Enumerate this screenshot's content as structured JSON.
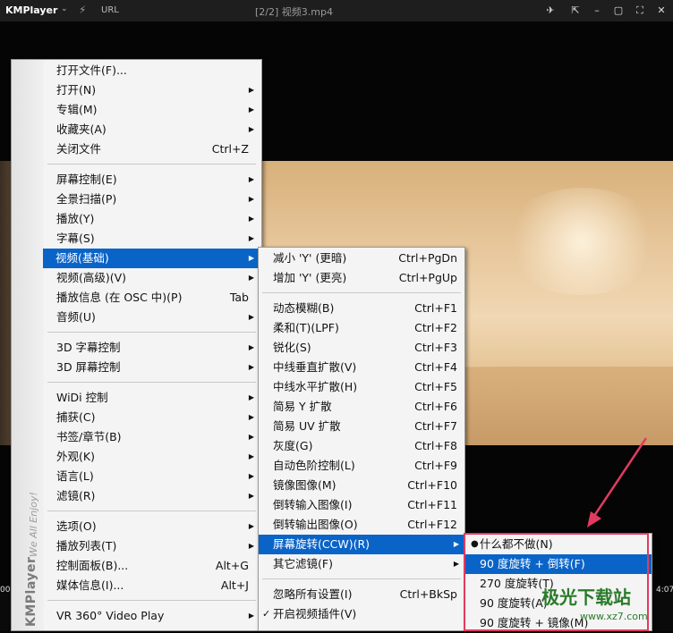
{
  "titlebar": {
    "app": "KMPlayer",
    "url": "URL",
    "title": "[2/2] 视频3.mp4"
  },
  "player": {
    "time_left": "00",
    "time_right": "4:07"
  },
  "main_menu": {
    "brand": "KMPlayer",
    "slogan": "We All Enjoy!",
    "items": [
      {
        "label": "打开文件(F)...",
        "shortcut": "",
        "arrow": false
      },
      {
        "label": "打开(N)",
        "shortcut": "",
        "arrow": true
      },
      {
        "label": "专辑(M)",
        "shortcut": "",
        "arrow": true
      },
      {
        "label": "收藏夹(A)",
        "shortcut": "",
        "arrow": true
      },
      {
        "label": "关闭文件",
        "shortcut": "Ctrl+Z",
        "arrow": false
      },
      {
        "label": "屏幕控制(E)",
        "shortcut": "",
        "arrow": true
      },
      {
        "label": "全景扫描(P)",
        "shortcut": "",
        "arrow": true
      },
      {
        "label": "播放(Y)",
        "shortcut": "",
        "arrow": true
      },
      {
        "label": "字幕(S)",
        "shortcut": "",
        "arrow": true
      },
      {
        "label": "视频(基础)",
        "shortcut": "",
        "arrow": true,
        "highlighted": true
      },
      {
        "label": "视频(高级)(V)",
        "shortcut": "",
        "arrow": true
      },
      {
        "label": "播放信息 (在 OSC 中)(P)",
        "shortcut": "Tab",
        "arrow": false
      },
      {
        "label": "音频(U)",
        "shortcut": "",
        "arrow": true
      },
      {
        "label": "3D 字幕控制",
        "shortcut": "",
        "arrow": true
      },
      {
        "label": "3D 屏幕控制",
        "shortcut": "",
        "arrow": true
      },
      {
        "label": "WiDi 控制",
        "shortcut": "",
        "arrow": true
      },
      {
        "label": "捕获(C)",
        "shortcut": "",
        "arrow": true
      },
      {
        "label": "书签/章节(B)",
        "shortcut": "",
        "arrow": true
      },
      {
        "label": "外观(K)",
        "shortcut": "",
        "arrow": true
      },
      {
        "label": "语言(L)",
        "shortcut": "",
        "arrow": true
      },
      {
        "label": "滤镜(R)",
        "shortcut": "",
        "arrow": true
      },
      {
        "label": "选项(O)",
        "shortcut": "",
        "arrow": true
      },
      {
        "label": "播放列表(T)",
        "shortcut": "",
        "arrow": true
      },
      {
        "label": "控制面板(B)...",
        "shortcut": "Alt+G",
        "arrow": false
      },
      {
        "label": "媒体信息(I)...",
        "shortcut": "Alt+J",
        "arrow": false
      },
      {
        "label": "VR 360° Video Play",
        "shortcut": "",
        "arrow": true
      }
    ]
  },
  "video_submenu": {
    "items": [
      {
        "label": "减小 'Y' (更暗)",
        "shortcut": "Ctrl+PgDn"
      },
      {
        "label": "增加 'Y' (更亮)",
        "shortcut": "Ctrl+PgUp"
      },
      {
        "label": "动态模糊(B)",
        "shortcut": "Ctrl+F1"
      },
      {
        "label": "柔和(T)(LPF)",
        "shortcut": "Ctrl+F2"
      },
      {
        "label": "锐化(S)",
        "shortcut": "Ctrl+F3"
      },
      {
        "label": "中线垂直扩散(V)",
        "shortcut": "Ctrl+F4"
      },
      {
        "label": "中线水平扩散(H)",
        "shortcut": "Ctrl+F5"
      },
      {
        "label": "简易 Y 扩散",
        "shortcut": "Ctrl+F6"
      },
      {
        "label": "简易 UV 扩散",
        "shortcut": "Ctrl+F7"
      },
      {
        "label": "灰度(G)",
        "shortcut": "Ctrl+F8"
      },
      {
        "label": "自动色阶控制(L)",
        "shortcut": "Ctrl+F9"
      },
      {
        "label": "镜像图像(M)",
        "shortcut": "Ctrl+F10"
      },
      {
        "label": "倒转输入图像(I)",
        "shortcut": "Ctrl+F11"
      },
      {
        "label": "倒转输出图像(O)",
        "shortcut": "Ctrl+F12"
      },
      {
        "label": "屏幕旋转(CCW)(R)",
        "shortcut": "",
        "arrow": true,
        "highlighted": true
      },
      {
        "label": "其它滤镜(F)",
        "shortcut": "",
        "arrow": true
      },
      {
        "label": "忽略所有设置(I)",
        "shortcut": "Ctrl+BkSp"
      },
      {
        "label": "开启视频插件(V)",
        "shortcut": "",
        "checked": true
      }
    ]
  },
  "rotation_submenu": {
    "items": [
      {
        "label": "什么都不做(N)",
        "selected": true
      },
      {
        "label": "90 度旋转 + 倒转(F)",
        "highlighted": true
      },
      {
        "label": "270 度旋转(T)"
      },
      {
        "label": "90 度旋转(A)"
      },
      {
        "label": "90 度旋转 + 镜像(M)"
      }
    ]
  },
  "watermark": {
    "text": "极光下载站",
    "url": "www.xz7.com"
  },
  "colors": {
    "highlight": "#0a64c8",
    "annotation": "#e23b5f"
  }
}
